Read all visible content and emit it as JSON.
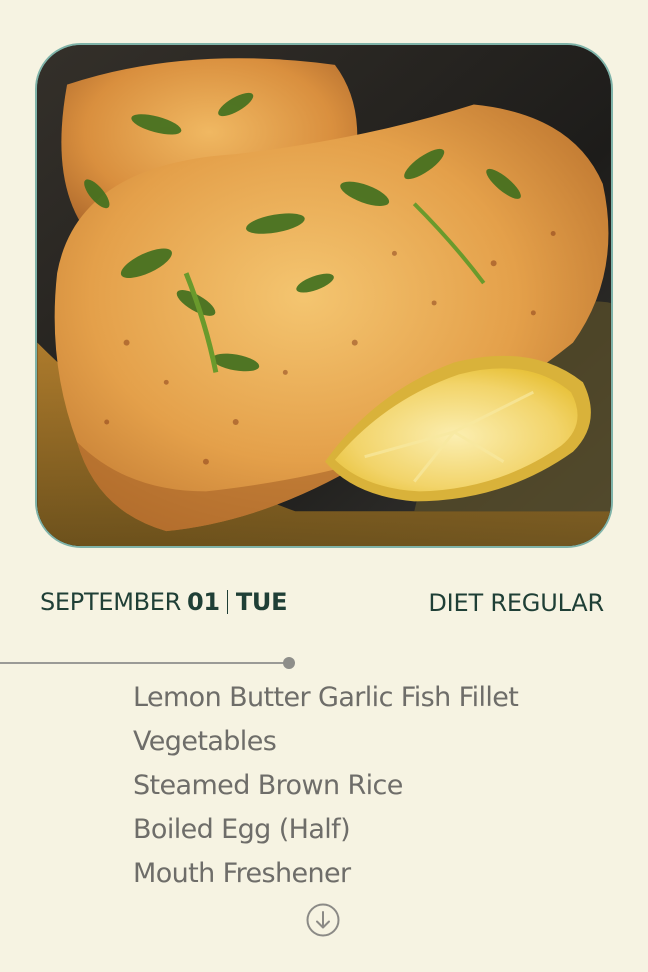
{
  "meal": {
    "image_alt": "Lemon butter garlic fish fillet in a skillet with lemon slice and herbs",
    "date": {
      "month": "SEPTEMBER",
      "day": "01",
      "weekday": "TUE"
    },
    "diet": "DIET REGULAR",
    "items": [
      "Lemon Butter Garlic Fish Fillet",
      "Vegetables",
      "Steamed Brown Rice",
      "Boiled Egg (Half)",
      "Mouth Freshener"
    ]
  },
  "icons": {
    "scroll_down": "arrow-down-circle-icon"
  },
  "colors": {
    "background": "#f6f3e2",
    "text_dark": "#1f3f36",
    "text_item": "#6e6d69",
    "card_border": "#7fb3a9"
  }
}
